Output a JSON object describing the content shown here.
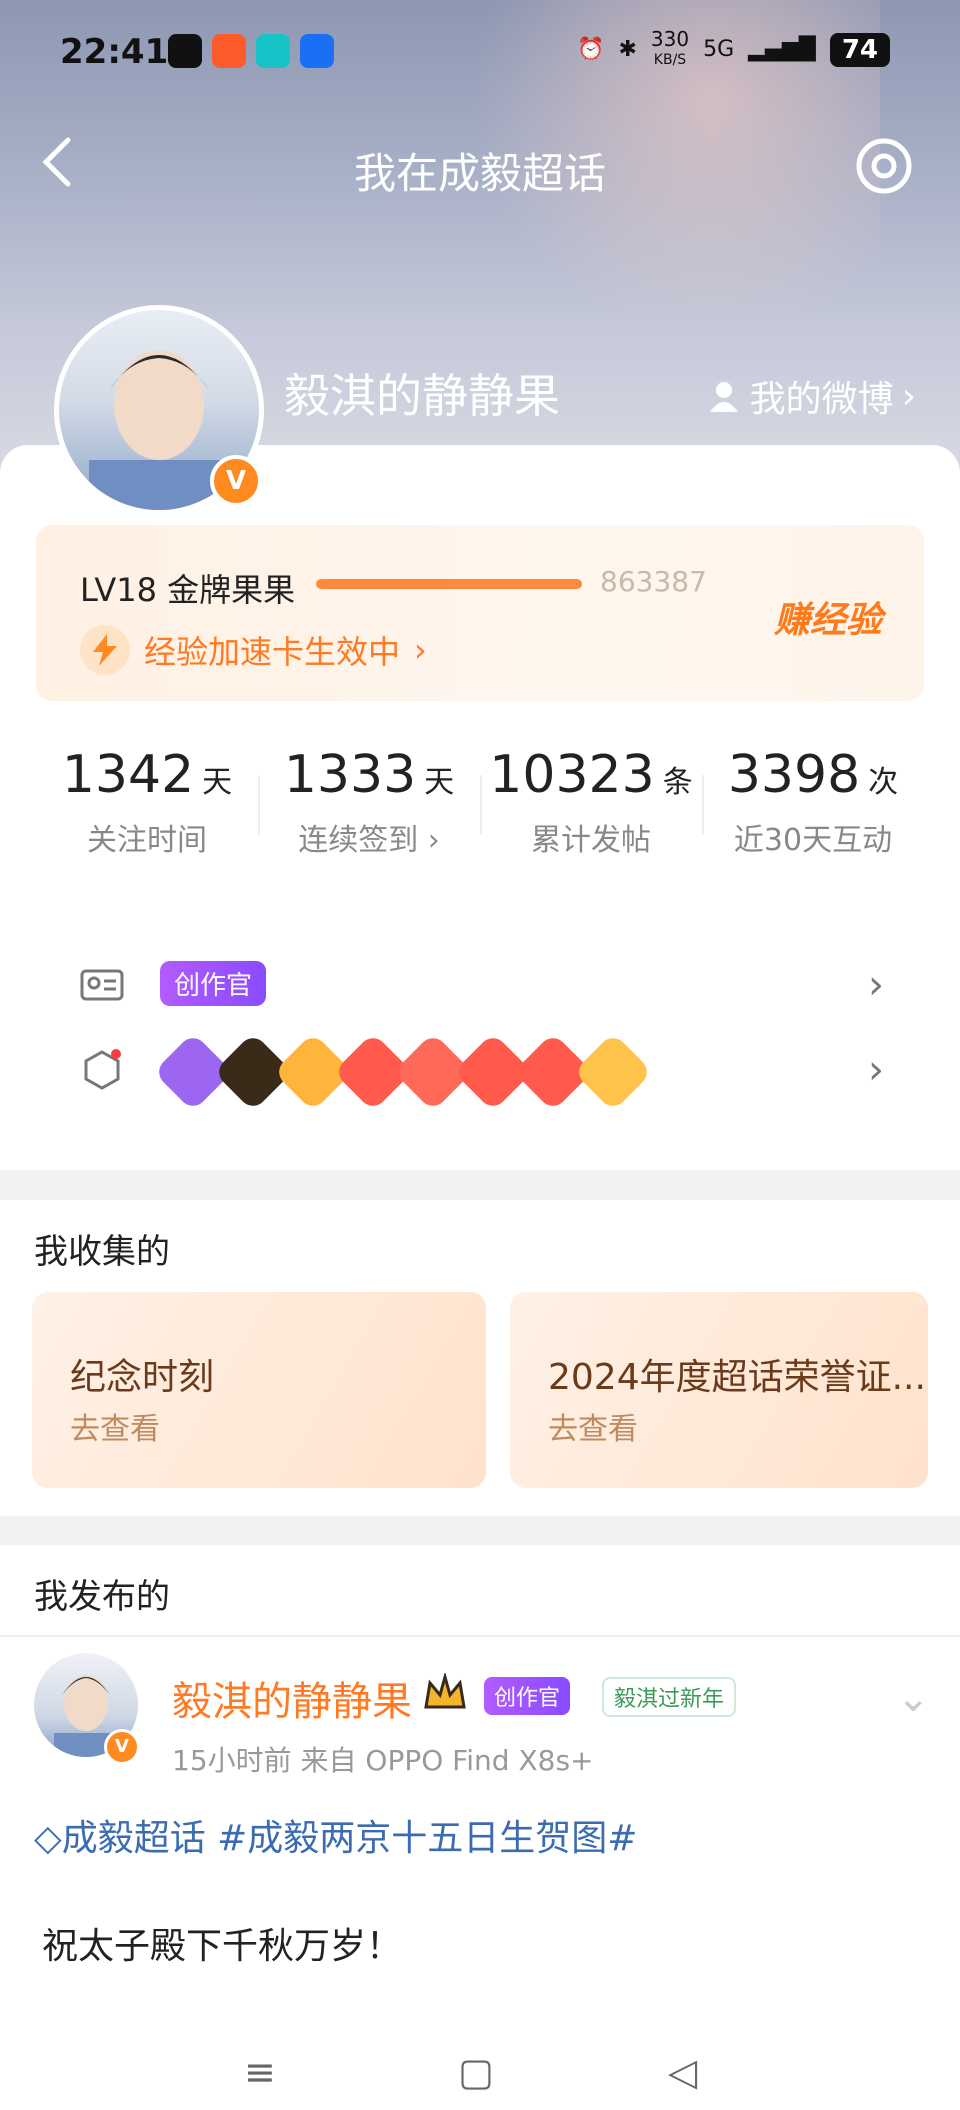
{
  "status": {
    "time": "22:41",
    "speed": "330",
    "speed_unit": "KB/S",
    "network": "5G",
    "battery": "74"
  },
  "nav": {
    "title": "我在成毅超话"
  },
  "profile": {
    "name": "毅淇的静静果",
    "my_weibo": "我的微博",
    "badge": "V"
  },
  "level": {
    "text": "LV18 金牌果果",
    "exp": "863387",
    "progress": 0.95,
    "boost": "经验加速卡生效中",
    "earn": "赚经验"
  },
  "stats": [
    {
      "value": "1342",
      "unit": "天",
      "label": "关注时间"
    },
    {
      "value": "1333",
      "unit": "天",
      "label": "连续签到"
    },
    {
      "value": "10323",
      "unit": "条",
      "label": "累计发帖"
    },
    {
      "value": "3398",
      "unit": "次",
      "label": "近30天互动"
    }
  ],
  "badges": {
    "creator": "创作官",
    "medal_colors": [
      "#9c66f0",
      "#3a2a18",
      "#ffb43b",
      "#ff5a4b",
      "#ff6a58",
      "#ff5a4b",
      "#ff5a4b",
      "#ffc24a"
    ]
  },
  "collected": {
    "title": "我收集的",
    "items": [
      {
        "title": "纪念时刻",
        "sub": "去查看"
      },
      {
        "title": "2024年度超话荣誉证...",
        "sub": "去查看"
      }
    ]
  },
  "posts": {
    "title": "我发布的",
    "name": "毅淇的静静果",
    "creator": "创作官",
    "newyear": "毅淇过新年",
    "meta": "15小时前   来自 OPPO Find X8s+",
    "tags": "成毅超话 #成毅两京十五日生贺图#",
    "content": "祝太子殿下千秋万岁！"
  }
}
